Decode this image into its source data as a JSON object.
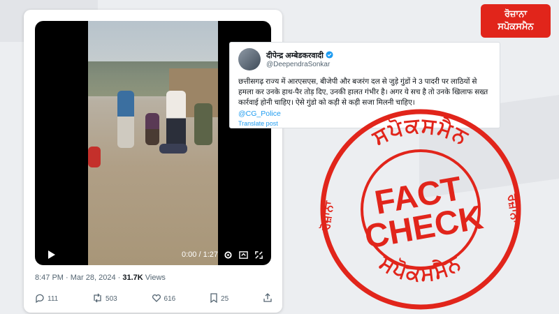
{
  "brand": {
    "line1": "ਰੋਜ਼ਾਨਾ",
    "line2": "ਸਪੋਕਸਮੈਨ",
    "color": "#e1251b"
  },
  "video": {
    "time": "0:00 / 1:27",
    "play_icon": "play-icon",
    "settings_icon": "gear-icon"
  },
  "tweet": {
    "timestamp": "8:47 PM · Mar 28, 2024 · ",
    "views_count": "31.7K",
    "views_label": " Views",
    "replies": "111",
    "retweets": "503",
    "likes": "616",
    "bookmarks": "25"
  },
  "quote": {
    "name": "दीपेन्द्र अम्बेडकरवादी",
    "handle": "@DeependraSonkar",
    "text": "छत्तीसगढ़ राज्य में आरएसएस, बीजेपी और बजरंग दल से जुड़े गुंडों ने 3 पादरी पर लाठियों से हमला कर उनके हाथ-पैर तोड़ दिए, उनकी हालत गंभीर है। अगर ये सच है तो उनके खिलाफ सख्त कार्रवाई होनी चाहिए। ऐसे गुंडो को कड़ी से कड़ी सजा मिलनी चाहिए।",
    "mention": "@CG_Police",
    "translate": "Translate post"
  },
  "stamp": {
    "ring_top": "ਸਪੋਕਸਮੈਨ",
    "ring_bottom": "ਸਪੋਕਸਮੈਨ",
    "left_word": "ਰੋਜ਼ਾਨਾ",
    "right_word": "ਰੋਜ਼ਾਨਾ",
    "fact": "FACT",
    "check": "CHECK",
    "color": "#e1251b"
  }
}
